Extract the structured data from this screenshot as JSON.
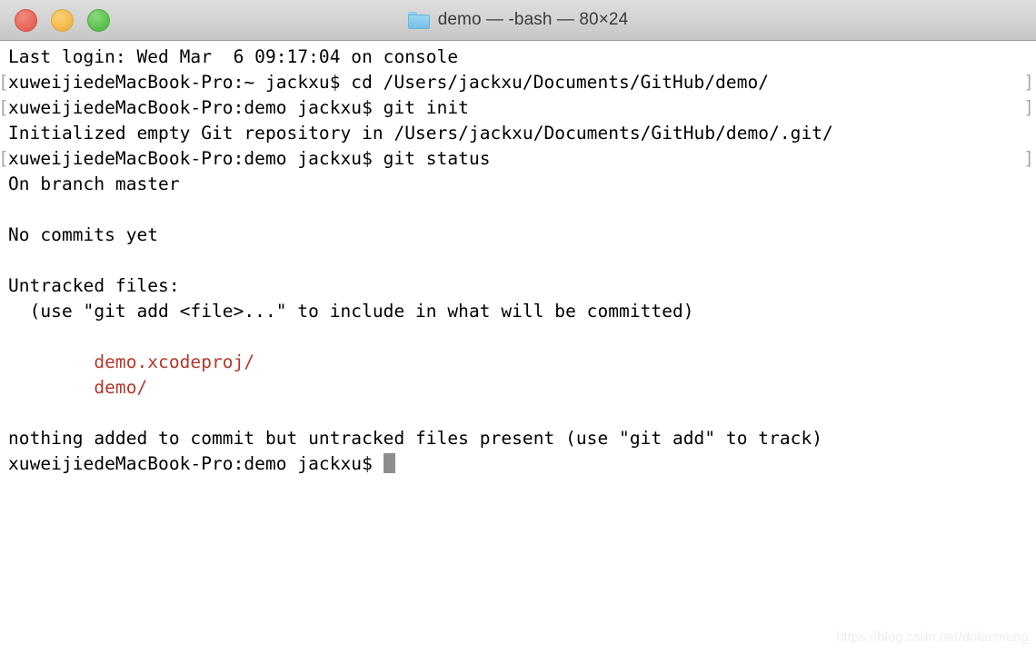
{
  "window": {
    "title": "demo — -bash — 80×24",
    "folder_icon": "folder-icon",
    "traffic_lights": {
      "close_label": "close",
      "minimize_label": "minimize",
      "zoom_label": "zoom",
      "close_color": "#ec6a5e",
      "minimize_color": "#f5bd4f",
      "zoom_color": "#61c554"
    }
  },
  "terminal": {
    "foreground_color": "#000000",
    "background_color": "#ffffff",
    "untracked_color": "#b5382a",
    "mark_color": "#a8a8a8",
    "cursor_color": "#8e8e8e",
    "mark_open": "[",
    "mark_close": "]",
    "lines": [
      {
        "text": "Last login: Wed Mar  6 09:17:04 on console",
        "mark": false,
        "color": "default"
      },
      {
        "text": "xuweijiedeMacBook-Pro:~ jackxu$ cd /Users/jackxu/Documents/GitHub/demo/",
        "mark": true,
        "color": "default"
      },
      {
        "text": "xuweijiedeMacBook-Pro:demo jackxu$ git init",
        "mark": true,
        "color": "default"
      },
      {
        "text": "Initialized empty Git repository in /Users/jackxu/Documents/GitHub/demo/.git/",
        "mark": false,
        "color": "default"
      },
      {
        "text": "xuweijiedeMacBook-Pro:demo jackxu$ git status",
        "mark": true,
        "color": "default"
      },
      {
        "text": "On branch master",
        "mark": false,
        "color": "default"
      },
      {
        "text": "",
        "mark": false,
        "color": "default"
      },
      {
        "text": "No commits yet",
        "mark": false,
        "color": "default"
      },
      {
        "text": "",
        "mark": false,
        "color": "default"
      },
      {
        "text": "Untracked files:",
        "mark": false,
        "color": "default"
      },
      {
        "text": "  (use \"git add <file>...\" to include in what will be committed)",
        "mark": false,
        "color": "default"
      },
      {
        "text": "",
        "mark": false,
        "color": "default"
      },
      {
        "text": "        demo.xcodeproj/",
        "mark": false,
        "color": "red"
      },
      {
        "text": "        demo/",
        "mark": false,
        "color": "red"
      },
      {
        "text": "",
        "mark": false,
        "color": "default"
      },
      {
        "text": "nothing added to commit but untracked files present (use \"git add\" to track)",
        "mark": false,
        "color": "default"
      }
    ],
    "prompt": {
      "text": "xuweijiedeMacBook-Pro:demo jackxu$ ",
      "cursor": "block"
    }
  },
  "watermark": {
    "text": "https://blog.csdn.net/dolacmeng"
  }
}
